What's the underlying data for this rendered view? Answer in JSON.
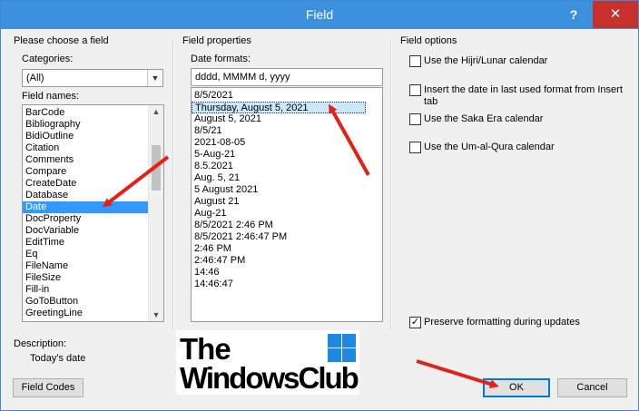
{
  "window": {
    "title": "Field",
    "help_label": "?",
    "close_label": "✕"
  },
  "field_panel": {
    "section_title": "Please choose a field",
    "categories_label": "Categories:",
    "categories_value": "(All)",
    "field_names_label": "Field names:",
    "field_names": [
      "BarCode",
      "Bibliography",
      "BidiOutline",
      "Citation",
      "Comments",
      "Compare",
      "CreateDate",
      "Database",
      "Date",
      "DocProperty",
      "DocVariable",
      "EditTime",
      "Eq",
      "FileName",
      "FileSize",
      "Fill-in",
      "GoToButton",
      "GreetingLine"
    ],
    "selected_field": "Date",
    "description_label": "Description:",
    "description_text": "Today's date",
    "field_codes_button": "Field Codes"
  },
  "properties_panel": {
    "section_title": "Field properties",
    "date_formats_label": "Date formats:",
    "date_format_value": "dddd, MMMM d, yyyy",
    "date_formats": [
      "8/5/2021",
      "Thursday, August 5, 2021",
      "August 5, 2021",
      "8/5/21",
      "2021-08-05",
      "5-Aug-21",
      "8.5.2021",
      "Aug. 5, 21",
      "5 August 2021",
      "August 21",
      "Aug-21",
      "8/5/2021 2:46 PM",
      "8/5/2021 2:46:47 PM",
      "2:46 PM",
      "2:46:47 PM",
      "14:46",
      "14:46:47"
    ],
    "selected_format": "Thursday, August 5, 2021"
  },
  "options_panel": {
    "section_title": "Field options",
    "options": [
      {
        "label": "Use the Hijri/Lunar calendar",
        "checked": false
      },
      {
        "label": "Insert the date in last used format from Insert tab",
        "checked": false
      },
      {
        "label": "Use the Saka Era calendar",
        "checked": false
      },
      {
        "label": "Use the Um-al-Qura calendar",
        "checked": false
      }
    ],
    "preserve_label": "Preserve formatting during updates",
    "preserve_checked": true,
    "check_mark": "✓"
  },
  "buttons": {
    "ok": "OK",
    "cancel": "Cancel"
  },
  "watermark": {
    "line1": "The",
    "line2": "WindowsClub"
  },
  "colors": {
    "title_bar": "#3d90dc",
    "close_button": "#c8302b",
    "selection": "#3399ff",
    "annotation_arrow": "#e0221b"
  }
}
